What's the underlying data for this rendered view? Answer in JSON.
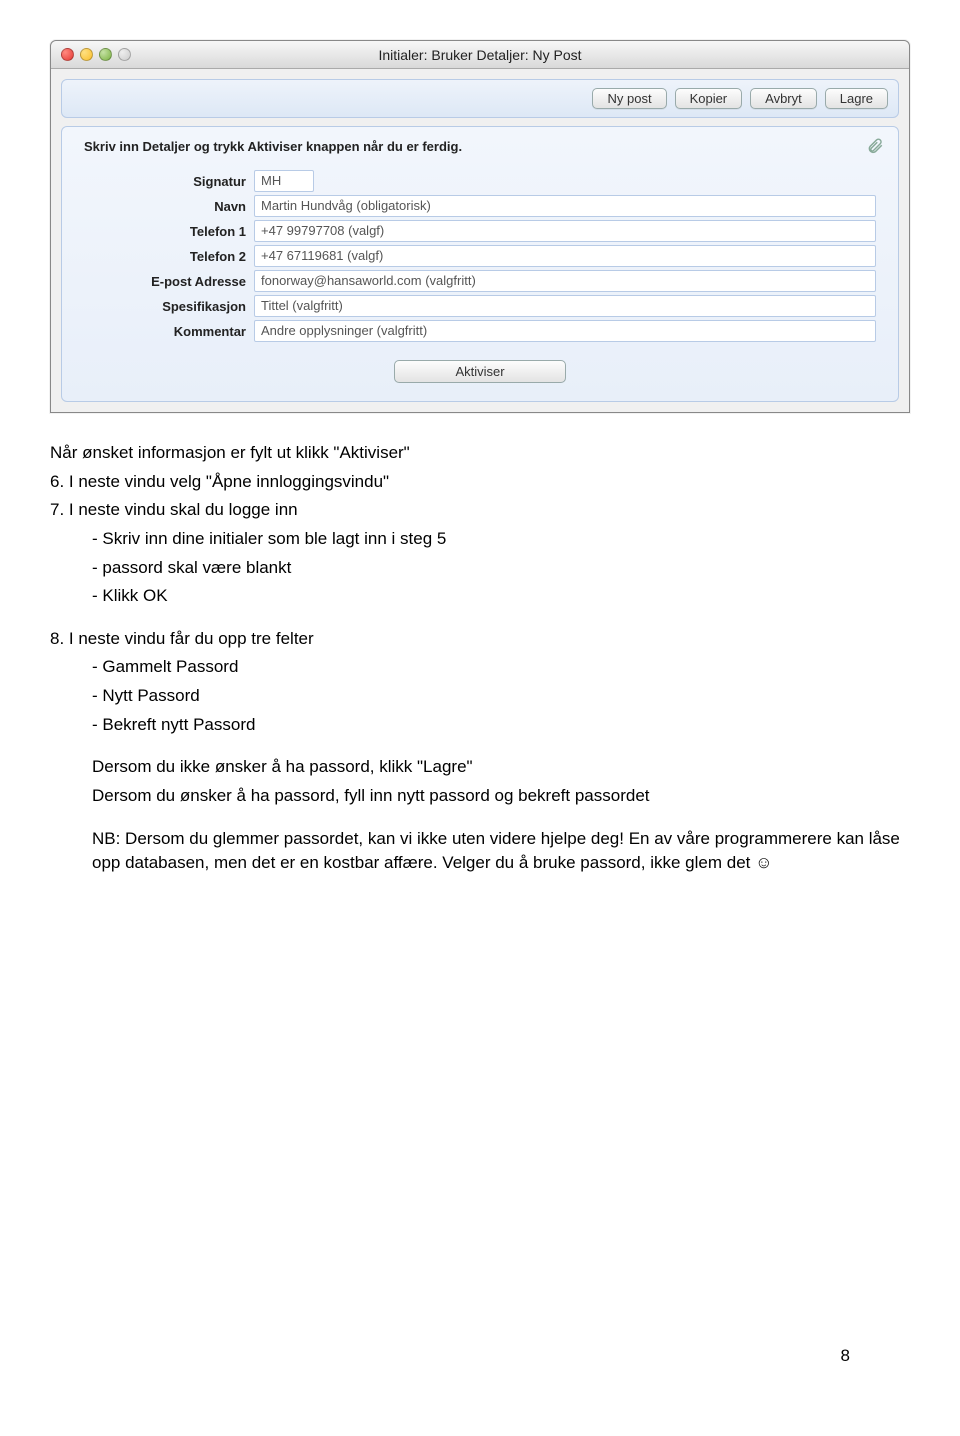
{
  "window": {
    "title": "Initialer: Bruker Detaljer: Ny Post"
  },
  "toolbar": {
    "new": "Ny post",
    "copy": "Kopier",
    "cancel": "Avbryt",
    "save": "Lagre"
  },
  "form": {
    "instruction": "Skriv inn Detaljer og trykk Aktiviser knappen når du er ferdig.",
    "labels": {
      "signature": "Signatur",
      "name": "Navn",
      "phone1": "Telefon 1",
      "phone2": "Telefon 2",
      "email": "E-post Adresse",
      "spec": "Spesifikasjon",
      "comment": "Kommentar"
    },
    "values": {
      "signature": "MH",
      "name": "Martin Hundvåg (obligatorisk)",
      "phone1": "+47 99797708 (valgf)",
      "phone2": "+47 67119681 (valgf)",
      "email": "fonorway@hansaworld.com (valgfritt)",
      "spec": "Tittel (valgfritt)",
      "comment": "Andre opplysninger (valgfritt)"
    },
    "activate": "Aktiviser"
  },
  "doc": {
    "l0": "Når ønsket informasjon er fylt ut klikk \"Aktiviser\"",
    "l1": "6. I neste vindu velg \"Åpne innloggingsvindu\"",
    "l2": "7. I neste vindu skal du logge inn",
    "l2a": "- Skriv inn dine initialer som ble lagt inn i steg 5",
    "l2b": "- passord skal være blankt",
    "l2c": "- Klikk OK",
    "l3": "8. I neste vindu får du opp tre felter",
    "l3a": "- Gammelt Passord",
    "l3b": "- Nytt Passord",
    "l3c": "- Bekreft nytt Passord",
    "l4": "Dersom du ikke ønsker å ha passord, klikk \"Lagre\"",
    "l5": "Dersom du ønsker å ha passord, fyll inn nytt passord og bekreft passordet",
    "l6": "NB: Dersom du glemmer passordet, kan vi ikke uten videre hjelpe deg! En av våre programmerere kan låse opp databasen, men det er en kostbar affære. Velger du å bruke passord, ikke glem det ☺"
  },
  "page_number": "8"
}
